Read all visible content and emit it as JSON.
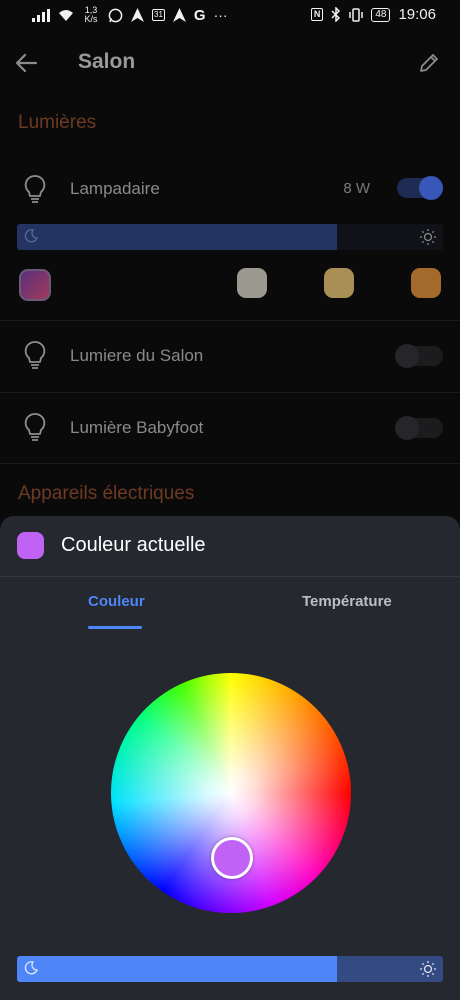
{
  "status_bar": {
    "net_speed_value": "1,3",
    "net_speed_unit": "K/s",
    "calendar_day": "31",
    "more": "···",
    "app_letter": "G",
    "battery": "48",
    "time": "19:06"
  },
  "header": {
    "title": "Salon"
  },
  "sections": {
    "lights_title": "Lumières",
    "devices_title": "Appareils électriques"
  },
  "lights": [
    {
      "name": "Lampadaire",
      "power": "8 W",
      "on": true,
      "brightness_fraction": 0.75
    },
    {
      "name": "Lumiere du Salon",
      "on": false
    },
    {
      "name": "Lumière Babyfoot",
      "on": false
    }
  ],
  "swatch_colors": [
    "#8a3a8a",
    "#9c9a90",
    "#a98f56",
    "#a36a2c"
  ],
  "sheet": {
    "title": "Couleur actuelle",
    "current_color": "#c063f5",
    "tabs": [
      {
        "label": "Couleur",
        "active": true
      },
      {
        "label": "Température",
        "active": false
      }
    ],
    "brightness_fraction": 0.75
  },
  "colors": {
    "accent_blue": "#4f86f7",
    "section_title": "#6e3a22",
    "toggle_on_knob": "#3857b8",
    "toggle_on_track": "#1f2b52",
    "slider_fill_dim": "#233462"
  }
}
